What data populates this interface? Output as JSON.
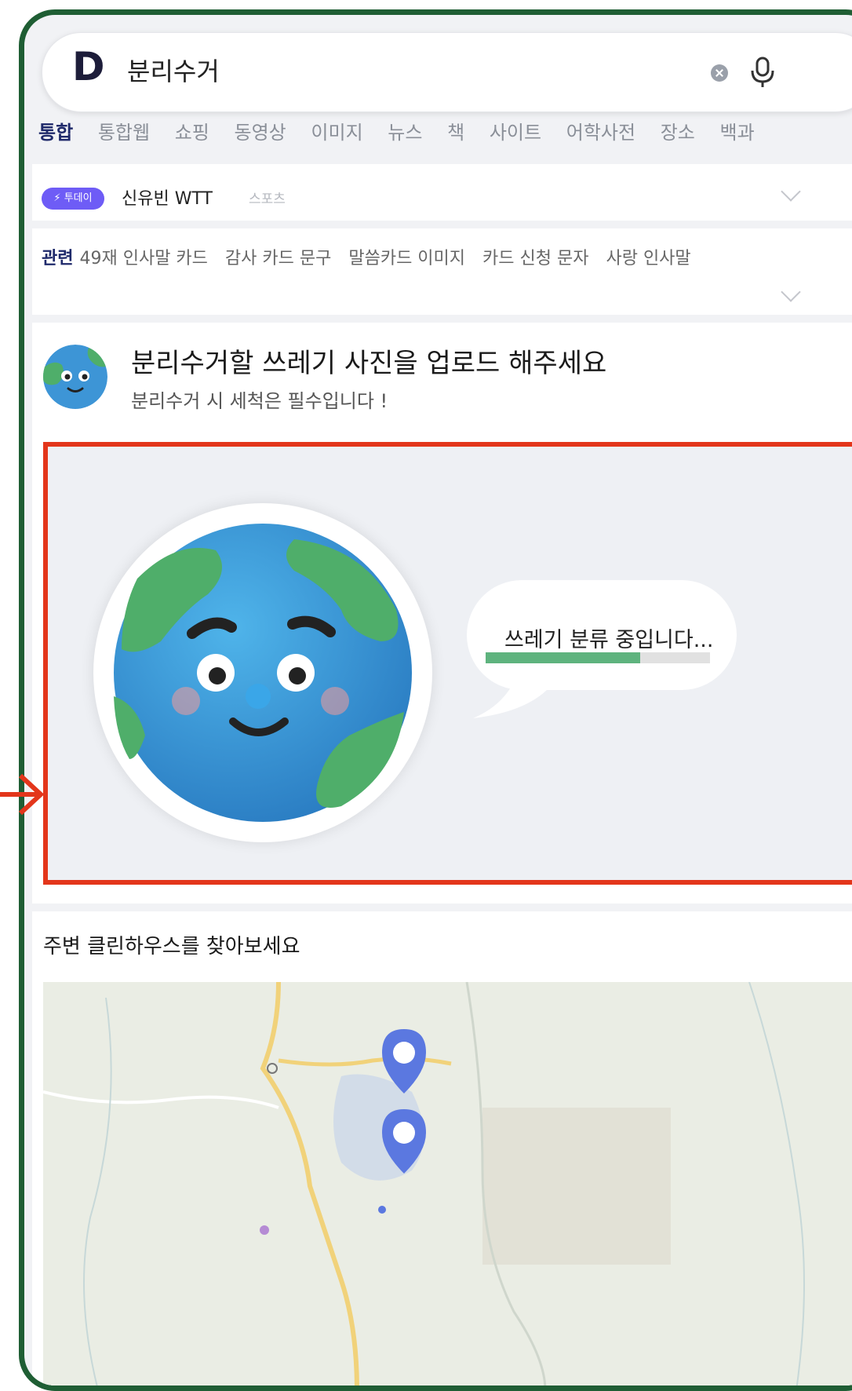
{
  "search": {
    "logo": "D",
    "query": "분리수거"
  },
  "tabs": [
    {
      "label": "통합",
      "active": true
    },
    {
      "label": "통합웹",
      "active": false
    },
    {
      "label": "쇼핑",
      "active": false
    },
    {
      "label": "동영상",
      "active": false
    },
    {
      "label": "이미지",
      "active": false
    },
    {
      "label": "뉴스",
      "active": false
    },
    {
      "label": "책",
      "active": false
    },
    {
      "label": "사이트",
      "active": false
    },
    {
      "label": "어학사전",
      "active": false
    },
    {
      "label": "장소",
      "active": false
    },
    {
      "label": "백과",
      "active": false
    }
  ],
  "today": {
    "badge": "투데이",
    "title": "신유빈 WTT",
    "tag": "스포츠"
  },
  "related": {
    "label": "관련",
    "items": [
      "49재 인사말 카드",
      "감사 카드 문구",
      "말씀카드 이미지",
      "카드 신청 문자",
      "사랑 인사말"
    ]
  },
  "card": {
    "title": "분리수거할 쓰레기 사진을 업로드 해주세요",
    "subtitle": "분리수거 시 세척은 필수입니다 !",
    "status_text": "쓰레기 분류 중입니다...",
    "progress": 0.69
  },
  "cleanhouse": {
    "title": "주변 클린하우스를 찾아보세요"
  },
  "colors": {
    "frame": "#1f5e34",
    "highlight": "#e3361b",
    "progress": "#5eb37e",
    "pin": "#5b78e0"
  },
  "icons": [
    "clear-icon",
    "mic-icon",
    "lightning-icon",
    "chevron-down-icon",
    "map-pin-icon",
    "arrow-right-icon"
  ]
}
